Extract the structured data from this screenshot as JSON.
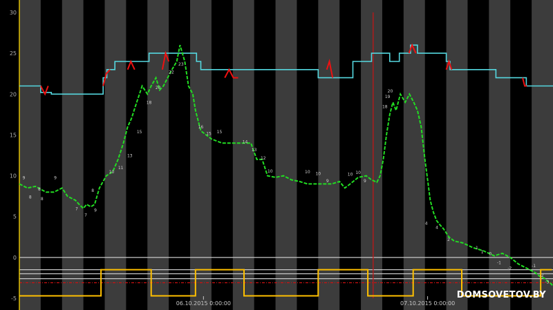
{
  "watermark": "DOMSOVETOV.BY",
  "chart_data": {
    "type": "line",
    "ylim": [
      -5,
      30
    ],
    "ytick_labels": [
      "30",
      "25",
      "20",
      "15",
      "10",
      "5",
      "0",
      "-5"
    ],
    "xlim": [
      0,
      100
    ],
    "x_date_labels": [
      {
        "x": 34.5,
        "label": "06.10.2015 0:00:00"
      },
      {
        "x": 76.5,
        "label": "07.10.2015 0:00:00"
      }
    ],
    "now_marker_x": 66.3,
    "colors": {
      "background": "#000000",
      "band_light": "#3c3c3c",
      "axis_left": "#e0c000",
      "outdoor": "#22dd22",
      "indoor": "#55d8e0",
      "indoor_alarm": "#ee1111",
      "heating_pulse": "#ffc000",
      "threshold": "#cc1111",
      "ref_line": "#c8c8c8",
      "now_line": "#c01818"
    },
    "reference_lines": [
      0,
      -1.5,
      -2.0,
      -2.6
    ],
    "threshold_level": -3.1,
    "series": [
      {
        "key": "indoor",
        "x": [
          0,
          3.5,
          4.0,
          5.5,
          6.0,
          15.0,
          15.7,
          16.4,
          17.1,
          17.9,
          18.6,
          20.0,
          22.2,
          24.3,
          25.4,
          26.6,
          28.3,
          30.0,
          33.2,
          34.0,
          50.0,
          51.8,
          56.0,
          57.2,
          61.0,
          62.5,
          64.0,
          66.0,
          68.1,
          69.4,
          70.3,
          71.2,
          72.0,
          73.3,
          74.6,
          80.0,
          80.7,
          87.5,
          89.3,
          94.0,
          95.0,
          99.5,
          100
        ],
        "values": [
          21,
          21,
          20.2,
          20.2,
          20,
          20,
          22,
          23,
          23,
          24,
          24,
          24,
          24,
          25,
          25,
          25,
          25,
          25,
          24,
          23,
          23,
          23,
          22,
          22,
          22,
          24,
          24,
          25,
          25,
          24,
          24,
          25,
          25,
          26,
          25,
          24,
          23,
          23,
          22,
          22,
          21,
          21,
          21
        ]
      },
      {
        "key": "indoor_alarm",
        "segments": [
          {
            "x": [
              4.0,
              4.8,
              5.4
            ],
            "values": [
              21,
              20,
              21
            ]
          },
          {
            "x": [
              15.7,
              16.3,
              17.0
            ],
            "values": [
              21,
              22.5,
              23
            ]
          },
          {
            "x": [
              20.3,
              20.9,
              21.6
            ],
            "values": [
              23,
              24,
              23
            ]
          },
          {
            "x": [
              26.8,
              27.4,
              28.0
            ],
            "values": [
              23,
              25,
              24
            ]
          },
          {
            "x": [
              38.5,
              39.3,
              40.1,
              41.0
            ],
            "values": [
              22,
              23,
              22,
              22
            ]
          },
          {
            "x": [
              57.6,
              58.1,
              58.7
            ],
            "values": [
              23,
              24,
              22
            ]
          },
          {
            "x": [
              73.0,
              73.6,
              74.3
            ],
            "values": [
              25,
              26,
              25
            ]
          },
          {
            "x": [
              80.0,
              80.5,
              81.0
            ],
            "values": [
              23,
              24,
              23
            ]
          },
          {
            "x": [
              94.3,
              94.7,
              95.1
            ],
            "values": [
              22,
              21,
              21
            ]
          }
        ]
      },
      {
        "key": "outdoor",
        "x": [
          0,
          1.5,
          3.0,
          5.0,
          6.5,
          8.0,
          9.0,
          10.5,
          11.2,
          12.0,
          12.6,
          13.4,
          14.1,
          15.0,
          16.3,
          17.5,
          18.5,
          19.5,
          20.3,
          21.0,
          22.0,
          23.0,
          24.0,
          24.7,
          25.6,
          26.3,
          27.0,
          27.8,
          28.6,
          29.5,
          30.1,
          31.0,
          31.7,
          32.5,
          33.0,
          34.0,
          36.0,
          38.0,
          40.0,
          42.0,
          43.4,
          44.5,
          45.5,
          46.5,
          48.0,
          49.5,
          51.0,
          52.5,
          54.0,
          55.5,
          57.0,
          58.5,
          60.0,
          61.0,
          62.0,
          63.5,
          65.0,
          66.0,
          67.0,
          67.6,
          68.2,
          68.8,
          69.4,
          70.0,
          70.6,
          71.4,
          72.3,
          73.1,
          73.9,
          74.6,
          75.3,
          76.0,
          76.6,
          77.0,
          77.6,
          78.2,
          78.8,
          79.5,
          80.5,
          81.5,
          83.0,
          85.0,
          87.0,
          89.0,
          90.5,
          92.0,
          93.5,
          95.0,
          96.5,
          97.5,
          98.5,
          99.1,
          99.6,
          100
        ],
        "values": [
          9,
          8.5,
          8.7,
          8,
          8,
          8.5,
          7.5,
          7,
          6.5,
          6,
          6.5,
          6.2,
          6.5,
          8.5,
          10,
          10.5,
          12,
          14,
          16,
          17,
          19,
          21,
          20,
          21,
          22,
          20.5,
          21,
          22,
          23,
          24,
          26,
          24,
          21,
          20,
          18,
          15.5,
          14.5,
          14,
          14,
          14,
          14,
          12,
          12,
          10,
          9.8,
          10,
          9.5,
          9.3,
          9,
          9,
          9,
          9,
          9.3,
          8.5,
          9,
          9.8,
          10,
          9.5,
          9.2,
          10,
          12,
          15,
          17.5,
          19,
          18,
          20,
          19,
          20,
          19,
          18,
          16,
          12,
          9,
          7,
          5.5,
          4.5,
          4,
          3.5,
          2.5,
          2,
          1.8,
          1.2,
          0.8,
          0.2,
          0.5,
          0,
          -0.8,
          -1.3,
          -1.8,
          -2.3,
          -2.6,
          -3,
          -3.2,
          -3.5
        ]
      },
      {
        "key": "heating_pulse",
        "x": [
          0,
          15.3,
          15.3,
          24.7,
          24.7,
          33.0,
          33.0,
          42.1,
          42.1,
          56.0,
          56.0,
          65.3,
          65.3,
          73.8,
          73.8,
          82.9,
          82.9,
          97.7,
          97.7,
          99.8
        ],
        "values": [
          -4.7,
          -4.7,
          -1.5,
          -1.5,
          -4.7,
          -4.7,
          -1.5,
          -1.5,
          -4.7,
          -4.7,
          -1.5,
          -1.5,
          -4.7,
          -4.7,
          -1.5,
          -1.5,
          -4.7,
          -4.7,
          -1.5,
          -1.5
        ]
      }
    ],
    "annotations": [
      {
        "x": 0.6,
        "y": 9.6,
        "text": "9"
      },
      {
        "x": 3.5,
        "y": 8.2,
        "text": "8"
      },
      {
        "x": 6.5,
        "y": 9.6,
        "text": "9"
      },
      {
        "x": 1.8,
        "y": 7.2,
        "text": "8"
      },
      {
        "x": 4.0,
        "y": 7.0,
        "text": "8"
      },
      {
        "x": 10.5,
        "y": 5.8,
        "text": "7"
      },
      {
        "x": 12.2,
        "y": 5.0,
        "text": "7"
      },
      {
        "x": 13.5,
        "y": 8.0,
        "text": "8"
      },
      {
        "x": 14.0,
        "y": 5.6,
        "text": "9"
      },
      {
        "x": 16.8,
        "y": 10.3,
        "text": "10"
      },
      {
        "x": 18.5,
        "y": 10.8,
        "text": "11"
      },
      {
        "x": 20.2,
        "y": 12.3,
        "text": "13"
      },
      {
        "x": 22.0,
        "y": 15.2,
        "text": "15"
      },
      {
        "x": 23.8,
        "y": 18.8,
        "text": "18"
      },
      {
        "x": 25.5,
        "y": 20.6,
        "text": "20"
      },
      {
        "x": 28.0,
        "y": 22.5,
        "text": "22"
      },
      {
        "x": 29.8,
        "y": 23.5,
        "text": "23"
      },
      {
        "x": 33.5,
        "y": 15.8,
        "text": "16"
      },
      {
        "x": 35.0,
        "y": 15.0,
        "text": "15"
      },
      {
        "x": 37.0,
        "y": 15.2,
        "text": "15"
      },
      {
        "x": 41.8,
        "y": 14.0,
        "text": "14"
      },
      {
        "x": 43.5,
        "y": 13.0,
        "text": "13"
      },
      {
        "x": 45.2,
        "y": 12.0,
        "text": "12"
      },
      {
        "x": 46.5,
        "y": 10.4,
        "text": "10"
      },
      {
        "x": 53.5,
        "y": 10.3,
        "text": "10"
      },
      {
        "x": 55.5,
        "y": 10.1,
        "text": "10"
      },
      {
        "x": 57.5,
        "y": 9.2,
        "text": "9"
      },
      {
        "x": 61.5,
        "y": 10.0,
        "text": "10"
      },
      {
        "x": 63.0,
        "y": 10.2,
        "text": "10"
      },
      {
        "x": 64.5,
        "y": 9.2,
        "text": "9"
      },
      {
        "x": 68.0,
        "y": 18.3,
        "text": "18"
      },
      {
        "x": 68.5,
        "y": 19.5,
        "text": "19"
      },
      {
        "x": 69.0,
        "y": 20.2,
        "text": "20"
      },
      {
        "x": 76.0,
        "y": 4.0,
        "text": "4"
      },
      {
        "x": 78.0,
        "y": 3.5,
        "text": "4"
      },
      {
        "x": 80.2,
        "y": 2.0,
        "text": "2"
      },
      {
        "x": 85.5,
        "y": 1.0,
        "text": "1"
      },
      {
        "x": 86.5,
        "y": 0.5,
        "text": "1"
      },
      {
        "x": 88.0,
        "y": 0.3,
        "text": "0"
      },
      {
        "x": 89.5,
        "y": -0.8,
        "text": "-1"
      },
      {
        "x": 91.5,
        "y": -1.5,
        "text": "-2"
      },
      {
        "x": 96.0,
        "y": -1.2,
        "text": "-1"
      },
      {
        "x": 97.5,
        "y": -2.4,
        "text": "-2"
      },
      {
        "x": 98.5,
        "y": -3.2,
        "text": "-3"
      }
    ]
  }
}
